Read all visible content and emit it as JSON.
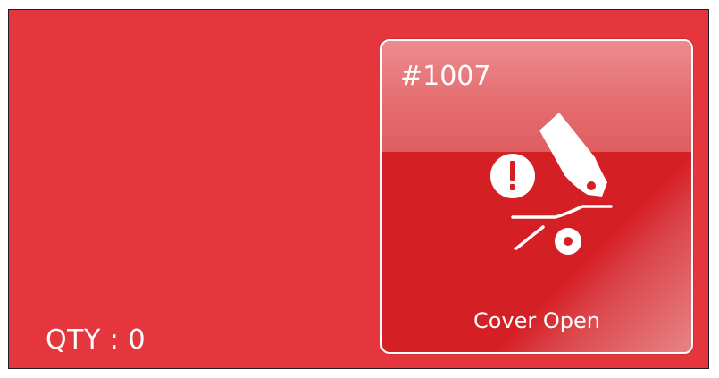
{
  "quantity": {
    "label": "QTY : 0"
  },
  "printer": {
    "id": "#1007",
    "status": "Cover Open",
    "icon": "cover-open-warning-icon"
  },
  "colors": {
    "panel_background": "#e6363d",
    "card_background": "#d41f25",
    "text": "#ffffff"
  }
}
